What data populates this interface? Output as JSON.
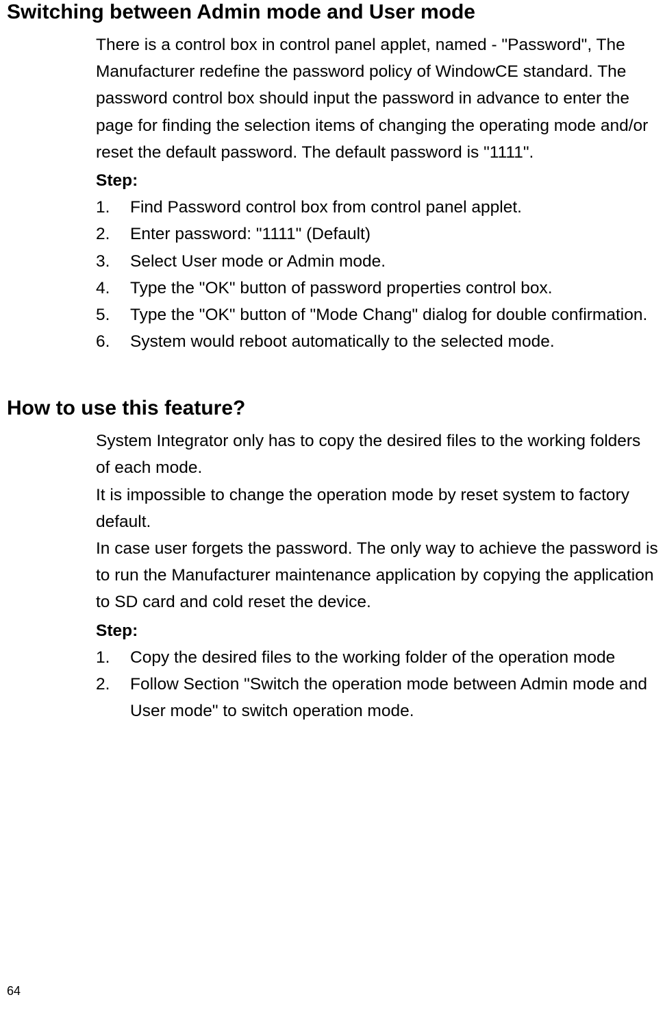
{
  "section1": {
    "heading": "Switching between Admin mode and User mode",
    "intro": "There is a control box in control panel applet, named - \"Password\", The Manufacturer redefine the password policy of WindowCE standard. The password control box should input the password in advance to enter the page for finding the selection items of changing the operating mode and/or reset the default password. The default password is \"1111\".",
    "step_label": "Step:",
    "steps": [
      {
        "num": "1.",
        "text": "Find Password control box from control panel applet."
      },
      {
        "num": "2.",
        "text": "Enter password: \"1111\" (Default)"
      },
      {
        "num": "3.",
        "text": "Select User mode or Admin mode."
      },
      {
        "num": "4.",
        "text": "Type the \"OK\" button of password properties control box."
      },
      {
        "num": "5.",
        "text": "Type the \"OK\" button of \"Mode Chang\" dialog for double confirmation."
      },
      {
        "num": "6.",
        "text": "System would reboot automatically to the selected mode."
      }
    ]
  },
  "section2": {
    "heading": "How to use this feature?",
    "para1": "System Integrator only has to copy the desired files to the working folders of each mode.",
    "para2": "It is impossible to change the operation mode by reset system to factory default.",
    "para3": "In case user forgets the password. The only way to achieve the password is to run the Manufacturer maintenance application by copying the application to SD card and cold reset the device.",
    "step_label": "Step:",
    "steps": [
      {
        "num": "1.",
        "text": "Copy the desired files to the working folder of the operation mode"
      },
      {
        "num": "2.",
        "text": "Follow Section \"Switch the operation mode between Admin mode and User mode\" to switch operation mode."
      }
    ]
  },
  "page_number": "64"
}
